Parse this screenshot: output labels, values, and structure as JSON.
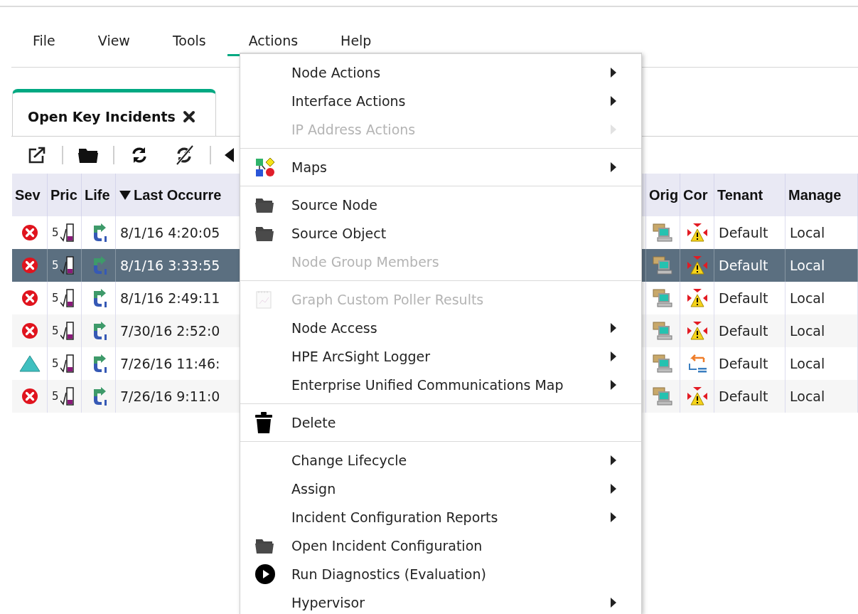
{
  "menubar": [
    {
      "label": "File",
      "selected": false
    },
    {
      "label": "View",
      "selected": false
    },
    {
      "label": "Tools",
      "selected": false
    },
    {
      "label": "Actions",
      "selected": true
    },
    {
      "label": "Help",
      "selected": false
    }
  ],
  "tab": {
    "title": "Open Key Incidents"
  },
  "table": {
    "columns": [
      {
        "label": "Sev",
        "kind": "severity"
      },
      {
        "label": "Pric",
        "kind": "priority"
      },
      {
        "label": "Life",
        "kind": "lifecycle"
      },
      {
        "label": "Last Occurre",
        "kind": "time",
        "sorted_descending": true
      },
      {
        "label": "Orig",
        "kind": "origin"
      },
      {
        "label": "Cor",
        "kind": "correlation"
      },
      {
        "label": "Tenant",
        "kind": "tenant"
      },
      {
        "label": "Manage",
        "kind": "management"
      }
    ],
    "rows": [
      {
        "selected": false,
        "critical": true,
        "priority": "5",
        "last_occurrence": "8/1/16 4:20:05",
        "root_cause": true,
        "tenant": "Default",
        "management": "Local"
      },
      {
        "selected": true,
        "critical": true,
        "priority": "5",
        "last_occurrence": "8/1/16 3:33:55",
        "root_cause": true,
        "tenant": "Default",
        "management": "Local"
      },
      {
        "selected": false,
        "critical": true,
        "priority": "5",
        "last_occurrence": "8/1/16 2:49:11",
        "root_cause": true,
        "tenant": "Default",
        "management": "Local"
      },
      {
        "selected": false,
        "critical": true,
        "priority": "5",
        "last_occurrence": "7/30/16 2:52:0",
        "root_cause": true,
        "tenant": "Default",
        "management": "Local"
      },
      {
        "selected": false,
        "critical": false,
        "priority": "5",
        "last_occurrence": "7/26/16 11:46:",
        "root_cause": false,
        "tenant": "Default",
        "management": "Local"
      },
      {
        "selected": false,
        "critical": true,
        "priority": "5",
        "last_occurrence": "7/26/16 9:11:0",
        "root_cause": true,
        "tenant": "Default",
        "management": "Local"
      }
    ]
  },
  "actions_menu": {
    "groups": [
      [
        {
          "label": "Node Actions",
          "kind": "text",
          "submenu": true,
          "disabled": false
        },
        {
          "label": "Interface Actions",
          "kind": "text",
          "submenu": true,
          "disabled": false
        },
        {
          "label": "IP Address Actions",
          "kind": "text",
          "submenu": true,
          "disabled": true
        }
      ],
      [
        {
          "label": "Maps",
          "kind": "maps",
          "submenu": true,
          "disabled": false
        }
      ],
      [
        {
          "label": "Source Node",
          "kind": "folder",
          "submenu": false,
          "disabled": false
        },
        {
          "label": "Source Object",
          "kind": "folder",
          "submenu": false,
          "disabled": false
        },
        {
          "label": "Node Group Members",
          "kind": "text",
          "submenu": false,
          "disabled": true
        }
      ],
      [
        {
          "label": "Graph Custom Poller Results",
          "kind": "graph",
          "submenu": false,
          "disabled": true
        },
        {
          "label": "Node Access",
          "kind": "text",
          "submenu": true,
          "disabled": false
        },
        {
          "label": "HPE ArcSight Logger",
          "kind": "text",
          "submenu": true,
          "disabled": false
        },
        {
          "label": "Enterprise Unified Communications Map",
          "kind": "text",
          "submenu": true,
          "disabled": false
        }
      ],
      [
        {
          "label": "Delete",
          "kind": "trash",
          "submenu": false,
          "disabled": false
        }
      ],
      [
        {
          "label": "Change Lifecycle",
          "kind": "text",
          "submenu": true,
          "disabled": false
        },
        {
          "label": "Assign",
          "kind": "text",
          "submenu": true,
          "disabled": false
        },
        {
          "label": "Incident Configuration Reports",
          "kind": "text",
          "submenu": true,
          "disabled": false
        },
        {
          "label": "Open Incident Configuration",
          "kind": "folder",
          "submenu": false,
          "disabled": false
        },
        {
          "label": "Run Diagnostics (Evaluation)",
          "kind": "play",
          "submenu": false,
          "disabled": false
        },
        {
          "label": "Hypervisor",
          "kind": "text",
          "submenu": true,
          "disabled": false
        }
      ]
    ]
  }
}
